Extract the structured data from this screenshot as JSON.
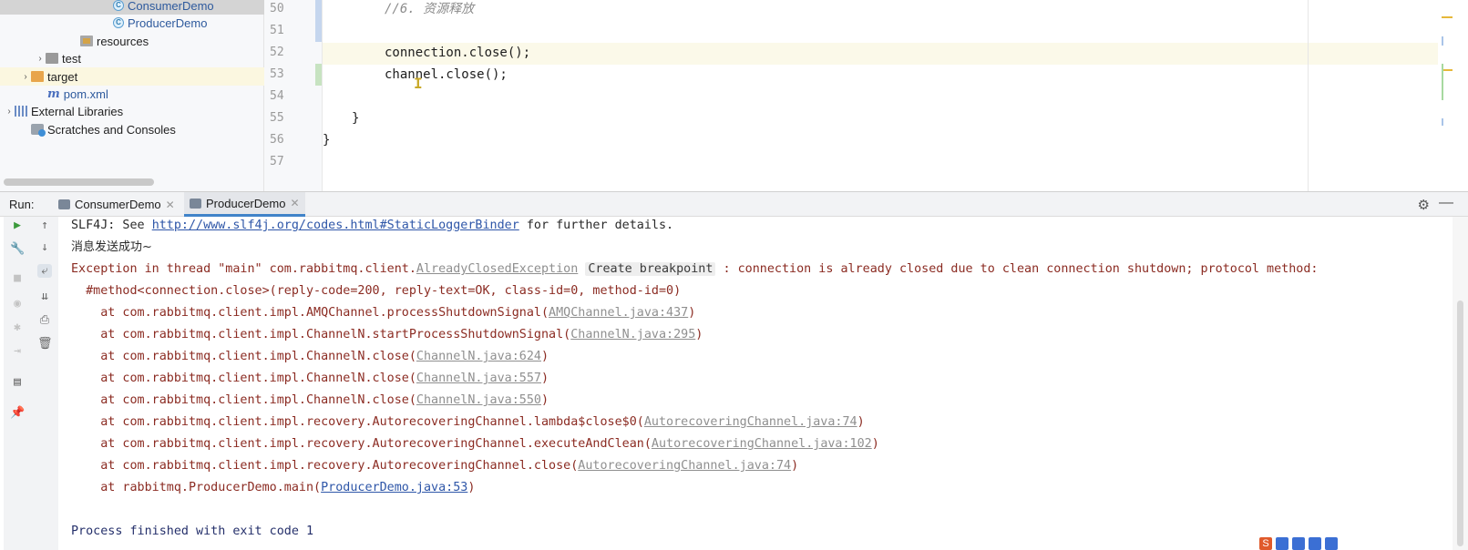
{
  "project_tree": [
    {
      "label": "ConsumerDemo",
      "icon": "class-icon",
      "indent": 0,
      "selected": true
    },
    {
      "label": "ProducerDemo",
      "icon": "class-icon"
    },
    {
      "label": "resources",
      "icon": "resources-folder-icon"
    },
    {
      "label": "test",
      "icon": "folder-icon",
      "expandable": true
    },
    {
      "label": "target",
      "icon": "folder-icon",
      "expandable": true,
      "highlighted": true
    },
    {
      "label": "pom.xml",
      "icon": "maven-icon"
    },
    {
      "label": "External Libraries",
      "icon": "library-icon",
      "expandable": true
    },
    {
      "label": "Scratches and Consoles",
      "icon": "scratch-icon"
    }
  ],
  "editor": {
    "line_numbers": [
      "50",
      "51",
      "52",
      "53",
      "54",
      "55",
      "56",
      "57"
    ],
    "lines": [
      {
        "text": "//6. 资源释放",
        "kind": "comment"
      },
      {
        "text": "",
        "kind": "code"
      },
      {
        "text": "connection.close();",
        "kind": "code"
      },
      {
        "text": "channel.close();",
        "kind": "code"
      },
      {
        "text": "",
        "kind": "code"
      },
      {
        "text": "}",
        "kind": "code"
      },
      {
        "text": "}",
        "kind": "code"
      },
      {
        "text": "",
        "kind": "code"
      }
    ]
  },
  "run_panel": {
    "label": "Run:",
    "tabs": [
      {
        "label": "ConsumerDemo",
        "active": false
      },
      {
        "label": "ProducerDemo",
        "active": true
      }
    ],
    "settings_icon": "gear-icon",
    "minimize_icon": "minimize-icon"
  },
  "console": {
    "slf4j_prefix": "SLF4J: See ",
    "slf4j_link": "http://www.slf4j.org/codes.html#StaticLoggerBinder",
    "slf4j_suffix": " for further details.",
    "message_sent": "消息发送成功~",
    "exception_prefix": "Exception in thread \"main\" com.rabbitmq.client.",
    "exception_class": "AlreadyClosedException",
    "create_breakpoint": "Create breakpoint",
    "exception_suffix": " : connection is already closed due to clean connection shutdown; protocol method:",
    "exception_line2": "  #method<connection.close>(reply-code=200, reply-text=OK, class-id=0, method-id=0)",
    "stack": [
      {
        "prefix": "    at com.rabbitmq.client.impl.AMQChannel.processShutdownSignal(",
        "link": "AMQChannel.java:437",
        "suffix": ")",
        "grey": true
      },
      {
        "prefix": "    at com.rabbitmq.client.impl.ChannelN.startProcessShutdownSignal(",
        "link": "ChannelN.java:295",
        "suffix": ")",
        "grey": true
      },
      {
        "prefix": "    at com.rabbitmq.client.impl.ChannelN.close(",
        "link": "ChannelN.java:624",
        "suffix": ")",
        "grey": true
      },
      {
        "prefix": "    at com.rabbitmq.client.impl.ChannelN.close(",
        "link": "ChannelN.java:557",
        "suffix": ")",
        "grey": true
      },
      {
        "prefix": "    at com.rabbitmq.client.impl.ChannelN.close(",
        "link": "ChannelN.java:550",
        "suffix": ")",
        "grey": true
      },
      {
        "prefix": "    at com.rabbitmq.client.impl.recovery.AutorecoveringChannel.lambda$close$0(",
        "link": "AutorecoveringChannel.java:74",
        "suffix": ")",
        "grey": true
      },
      {
        "prefix": "    at com.rabbitmq.client.impl.recovery.AutorecoveringChannel.executeAndClean(",
        "link": "AutorecoveringChannel.java:102",
        "suffix": ")",
        "grey": true
      },
      {
        "prefix": "    at com.rabbitmq.client.impl.recovery.AutorecoveringChannel.close(",
        "link": "AutorecoveringChannel.java:74",
        "suffix": ")",
        "grey": true
      },
      {
        "prefix": "    at rabbitmq.ProducerDemo.main(",
        "link": "ProducerDemo.java:53",
        "suffix": ")",
        "grey": false
      }
    ],
    "exit_message": "Process finished with exit code 1"
  },
  "colors": {
    "error_text": "#8b2b22",
    "link_blue": "#2e56a8",
    "tab_underline": "#4083c9"
  }
}
